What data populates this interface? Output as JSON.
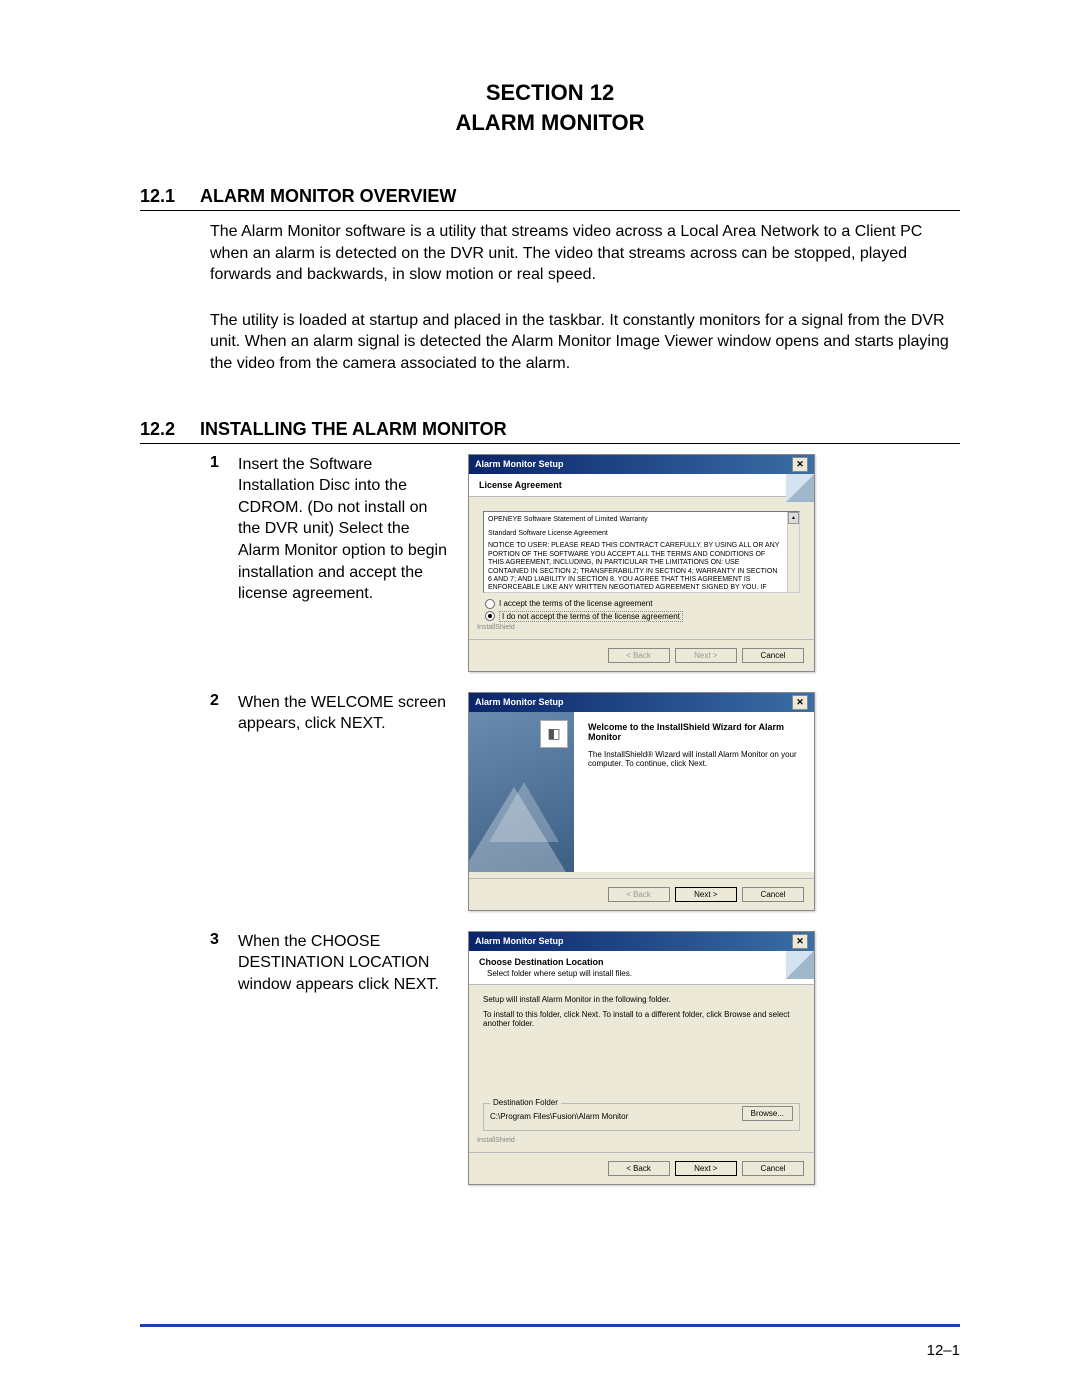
{
  "section": {
    "line1": "SECTION 12",
    "line2": "ALARM MONITOR"
  },
  "h1": {
    "num": "12.1",
    "text": "ALARM MONITOR OVERVIEW"
  },
  "overview_p1": "The Alarm Monitor software is a utility that streams video across a Local Area Network to a Client PC when an alarm is detected on the DVR unit. The video that streams across can be stopped, played forwards and backwards, in slow motion or real speed.",
  "overview_p2": "The utility is loaded at startup and placed in the taskbar. It constantly monitors for a signal from the DVR unit. When an alarm signal is detected the Alarm Monitor Image Viewer window opens and starts playing the video from the camera associated to the alarm.",
  "h2": {
    "num": "12.2",
    "text": "INSTALLING THE ALARM MONITOR"
  },
  "steps": [
    {
      "num": "1",
      "text": "Insert the Software Installation Disc into the CDROM. (Do not install on the DVR unit) Select the Alarm Monitor option to begin installation and accept the license agreement."
    },
    {
      "num": "2",
      "text": "When the WELCOME screen appears, click NEXT."
    },
    {
      "num": "3",
      "text": "When the CHOOSE DESTINATION LOCATION window appears click NEXT."
    }
  ],
  "win1": {
    "title": "Alarm Monitor Setup",
    "header": "License Agreement",
    "license_top": "OPENEYE Software Statement of Limited Warranty",
    "license_sub": "Standard Software License Agreement",
    "license_body": "NOTICE TO USER: PLEASE READ THIS CONTRACT CAREFULLY. BY USING ALL OR ANY PORTION OF THE SOFTWARE YOU ACCEPT ALL THE TERMS AND CONDITIONS OF THIS AGREEMENT, INCLUDING, IN PARTICULAR THE LIMITATIONS ON: USE CONTAINED IN SECTION 2; TRANSFERABILITY IN SECTION 4; WARRANTY IN SECTION 6 AND 7; AND LIABILITY IN SECTION 8. YOU AGREE THAT THIS AGREEMENT IS ENFORCEABLE LIKE ANY WRITTEN NEGOTIATED AGREEMENT SIGNED BY YOU. IF YOU DO NOT AGREE, DO NOT USE THIS",
    "radio_accept": "I accept the terms of the license agreement",
    "radio_reject": "I do not accept the terms of the license agreement",
    "brand": "InstallShield",
    "btn_back": "< Back",
    "btn_next": "Next >",
    "btn_cancel": "Cancel"
  },
  "win2": {
    "title": "Alarm Monitor Setup",
    "welcome_title": "Welcome to the InstallShield Wizard for Alarm Monitor",
    "welcome_body": "The InstallShield® Wizard will install Alarm Monitor on your computer. To continue, click Next.",
    "btn_back": "< Back",
    "btn_next": "Next >",
    "btn_cancel": "Cancel"
  },
  "win3": {
    "title": "Alarm Monitor Setup",
    "header": "Choose Destination Location",
    "header_sub": "Select folder where setup will install files.",
    "body1": "Setup will install Alarm Monitor in the following folder.",
    "body2": "To install to this folder, click Next. To install to a different folder, click Browse and select another folder.",
    "dest_label": "Destination Folder",
    "dest_path": "C:\\Program Files\\Fusion\\Alarm Monitor",
    "btn_browse": "Browse...",
    "brand": "InstallShield",
    "btn_back": "< Back",
    "btn_next": "Next >",
    "btn_cancel": "Cancel"
  },
  "page_number": "12–1"
}
